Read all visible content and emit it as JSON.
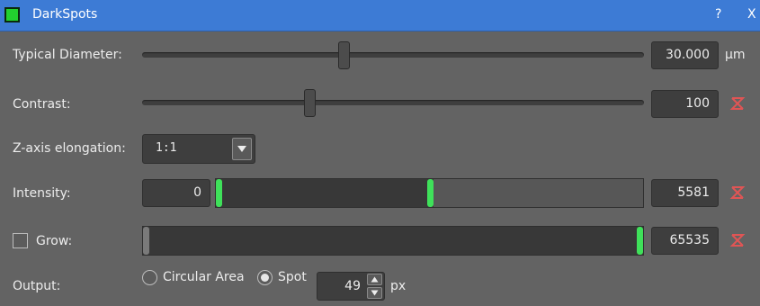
{
  "window": {
    "title": "DarkSpots",
    "help_label": "?",
    "close_label": "X"
  },
  "colors": {
    "title_bar": "#3d7bd5",
    "app_icon": "#22d12f",
    "range_handle": "#3fe15a",
    "reset_icon": "#e05555"
  },
  "typical_diameter": {
    "label": "Typical Diameter:",
    "value": "30.000",
    "unit": "µm",
    "slider_position": 0.4
  },
  "contrast": {
    "label": "Contrast:",
    "value": "100",
    "slider_position": 0.33,
    "reset_icon": "reset-icon"
  },
  "z_axis": {
    "label": "Z-axis elongation:",
    "selected": "1:1",
    "dropdown_icon": "chevron-down-icon"
  },
  "intensity": {
    "label": "Intensity:",
    "min_value": "0",
    "max_value": "5581",
    "range_start_fraction": 0.0,
    "range_end_fraction": 0.5
  },
  "grow": {
    "label": "Grow:",
    "checked": false,
    "value": "65535",
    "range_end_fraction": 1.0
  },
  "output": {
    "label": "Output:",
    "options": [
      {
        "label": "Circular Area",
        "checked": false
      },
      {
        "label": "Spot",
        "checked": true
      }
    ],
    "spin_value": "49",
    "spin_unit": "px"
  }
}
